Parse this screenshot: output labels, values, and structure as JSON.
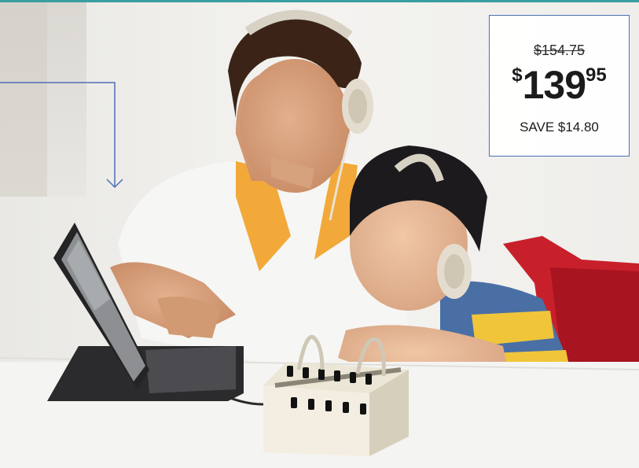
{
  "price": {
    "original": "$154.75",
    "currency": "$",
    "dollars": "139",
    "cents": "95",
    "save": "SAVE $14.80"
  },
  "colors": {
    "accent_rule": "#3a9ea0",
    "callout": "#4d6fb5",
    "desk": "#f4f4f2",
    "red_chair": "#c8202b"
  },
  "icons": [
    "callout-arrow-icon"
  ]
}
